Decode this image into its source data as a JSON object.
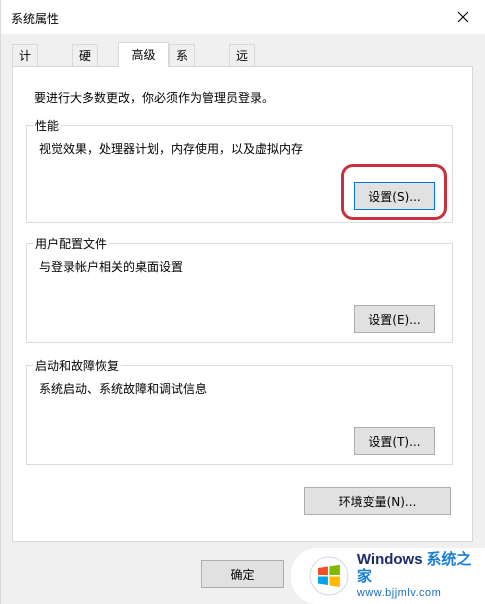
{
  "window": {
    "title": "系统属性"
  },
  "tabs": [
    {
      "label": "计算机名",
      "active": false
    },
    {
      "label": "硬件",
      "active": false
    },
    {
      "label": "高级",
      "active": true
    },
    {
      "label": "系统保护",
      "active": false
    },
    {
      "label": "远程",
      "active": false
    }
  ],
  "notice": "要进行大多数更改，你必须作为管理员登录。",
  "groups": {
    "performance": {
      "title": "性能",
      "description": "视觉效果，处理器计划，内存使用，以及虚拟内存",
      "button": "设置(S)..."
    },
    "user_profiles": {
      "title": "用户配置文件",
      "description": "与登录帐户相关的桌面设置",
      "button": "设置(E)..."
    },
    "startup_recovery": {
      "title": "启动和故障恢复",
      "description": "系统启动、系统故障和调试信息",
      "button": "设置(T)..."
    }
  },
  "env_button": "环境变量(N)...",
  "ok_button": "确定",
  "watermark": {
    "brand": "Windows",
    "site": "系统之家",
    "url": "www.bjjmlv.com"
  },
  "colors": {
    "highlight": "#c8323c",
    "focus": "#0078d7"
  }
}
